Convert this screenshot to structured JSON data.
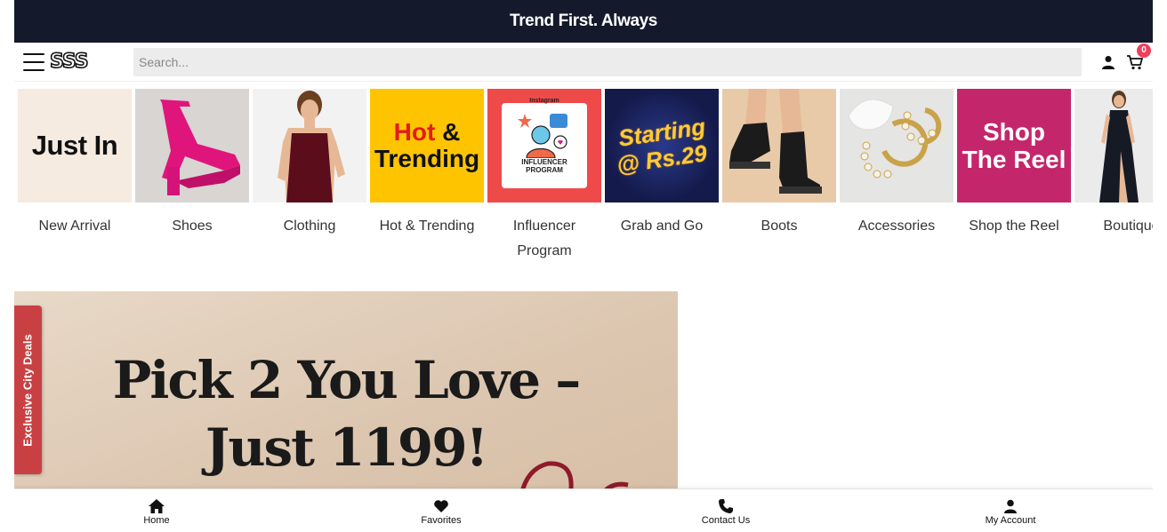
{
  "announcement": "Trend First. Always",
  "header": {
    "logo": "SSS",
    "search_placeholder": "Search...",
    "cart_count": "0"
  },
  "categories": [
    {
      "label": "New Arrival",
      "tile_text": "Just In"
    },
    {
      "label": "Shoes"
    },
    {
      "label": "Clothing"
    },
    {
      "label": "Hot & Trending",
      "tile_text_1": "Hot",
      "tile_text_amp": "&",
      "tile_text_2": "Trending"
    },
    {
      "label": "Influencer Program",
      "tile_text_ig": "Instagram",
      "tile_text_1": "INFLUENCER",
      "tile_text_2": "PROGRAM"
    },
    {
      "label": "Grab and Go",
      "tile_text_1": "Starting",
      "tile_text_2": "@ Rs.29"
    },
    {
      "label": "Boots"
    },
    {
      "label": "Accessories"
    },
    {
      "label": "Shop the Reel",
      "tile_text_1": "Shop",
      "tile_text_2": "The Reel"
    },
    {
      "label": "Boutique"
    }
  ],
  "banner": {
    "line1": "Pick 2 You Love –",
    "line2": "Just 1199!"
  },
  "side_tab": "Exclusive City Deals",
  "bottom_nav": [
    {
      "label": "Home",
      "icon": "home-icon"
    },
    {
      "label": "Favorites",
      "icon": "heart-icon"
    },
    {
      "label": "Contact Us",
      "icon": "phone-icon"
    },
    {
      "label": "My Account",
      "icon": "user-icon"
    }
  ],
  "colors": {
    "announcement_bg": "#141a2b",
    "badge": "#ee3e5c",
    "side_tab": "#c94043",
    "hot_tile": "#ffc400",
    "reel_tile": "#c4266c"
  }
}
